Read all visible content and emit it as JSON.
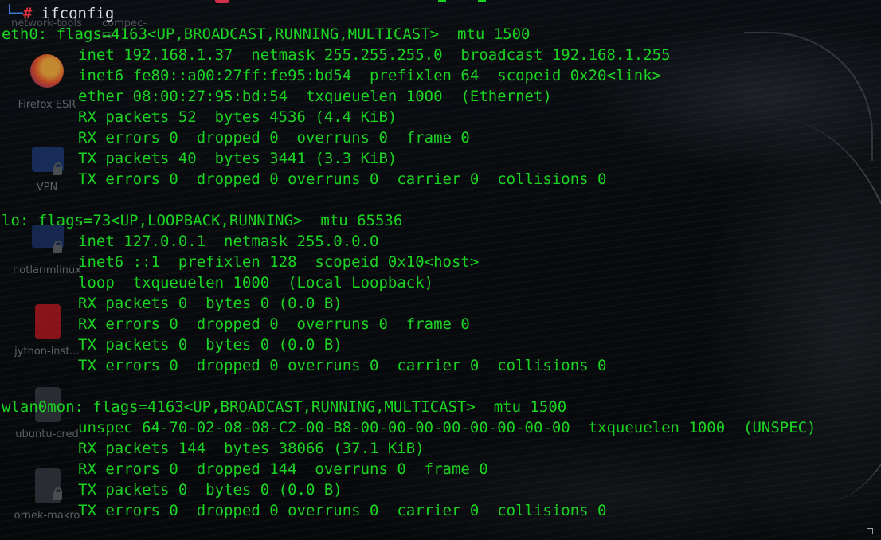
{
  "desktop": {
    "top_labels": [
      "network-tools",
      "compec-ss"
    ],
    "icons": [
      {
        "label": "Firefox ESR",
        "icon": "firefox-icon"
      },
      {
        "label": "VPN",
        "icon": "folder-lock-icon"
      },
      {
        "label": "notlarımlinux",
        "icon": "folder-lock-icon"
      },
      {
        "label": "jython-inst...",
        "icon": "java-file-icon"
      },
      {
        "label": "ubuntu-cred",
        "icon": "file-icon"
      },
      {
        "label": "ornek-makro",
        "icon": "file-lock-icon"
      }
    ]
  },
  "terminal": {
    "prompt_symbol": "#",
    "command": "ifconfig",
    "lines": [
      {
        "text": "eth0: flags=4163<UP,BROADCAST,RUNNING,MULTICAST>  mtu 1500",
        "indent": false
      },
      {
        "text": "inet 192.168.1.37  netmask 255.255.255.0  broadcast 192.168.1.255",
        "indent": true
      },
      {
        "text": "inet6 fe80::a00:27ff:fe95:bd54  prefixlen 64  scopeid 0x20<link>",
        "indent": true
      },
      {
        "text": "ether 08:00:27:95:bd:54  txqueuelen 1000  (Ethernet)",
        "indent": true
      },
      {
        "text": "RX packets 52  bytes 4536 (4.4 KiB)",
        "indent": true
      },
      {
        "text": "RX errors 0  dropped 0  overruns 0  frame 0",
        "indent": true
      },
      {
        "text": "TX packets 40  bytes 3441 (3.3 KiB)",
        "indent": true
      },
      {
        "text": "TX errors 0  dropped 0 overruns 0  carrier 0  collisions 0",
        "indent": true
      },
      {
        "text": "",
        "indent": false
      },
      {
        "text": "lo: flags=73<UP,LOOPBACK,RUNNING>  mtu 65536",
        "indent": false
      },
      {
        "text": "inet 127.0.0.1  netmask 255.0.0.0",
        "indent": true
      },
      {
        "text": "inet6 ::1  prefixlen 128  scopeid 0x10<host>",
        "indent": true
      },
      {
        "text": "loop  txqueuelen 1000  (Local Loopback)",
        "indent": true
      },
      {
        "text": "RX packets 0  bytes 0 (0.0 B)",
        "indent": true
      },
      {
        "text": "RX errors 0  dropped 0  overruns 0  frame 0",
        "indent": true
      },
      {
        "text": "TX packets 0  bytes 0 (0.0 B)",
        "indent": true
      },
      {
        "text": "TX errors 0  dropped 0 overruns 0  carrier 0  collisions 0",
        "indent": true
      },
      {
        "text": "",
        "indent": false
      },
      {
        "text": "wlan0mon: flags=4163<UP,BROADCAST,RUNNING,MULTICAST>  mtu 1500",
        "indent": false
      },
      {
        "text": "unspec 64-70-02-08-08-C2-00-B8-00-00-00-00-00-00-00-00  txqueuelen 1000  (UNSPEC)",
        "indent": true
      },
      {
        "text": "RX packets 144  bytes 38066 (37.1 KiB)",
        "indent": true
      },
      {
        "text": "RX errors 0  dropped 144  overruns 0  frame 0",
        "indent": true
      },
      {
        "text": "TX packets 0  bytes 0 (0.0 B)",
        "indent": true
      },
      {
        "text": "TX errors 0  dropped 0 overruns 0  carrier 0  collisions 0",
        "indent": true
      }
    ]
  },
  "colors": {
    "output_text": "#1bd322",
    "prompt_hash": "#e0313e",
    "prompt_corner": "#3c7bd8",
    "command_text": "#d8dde4",
    "background": "#07090c"
  }
}
